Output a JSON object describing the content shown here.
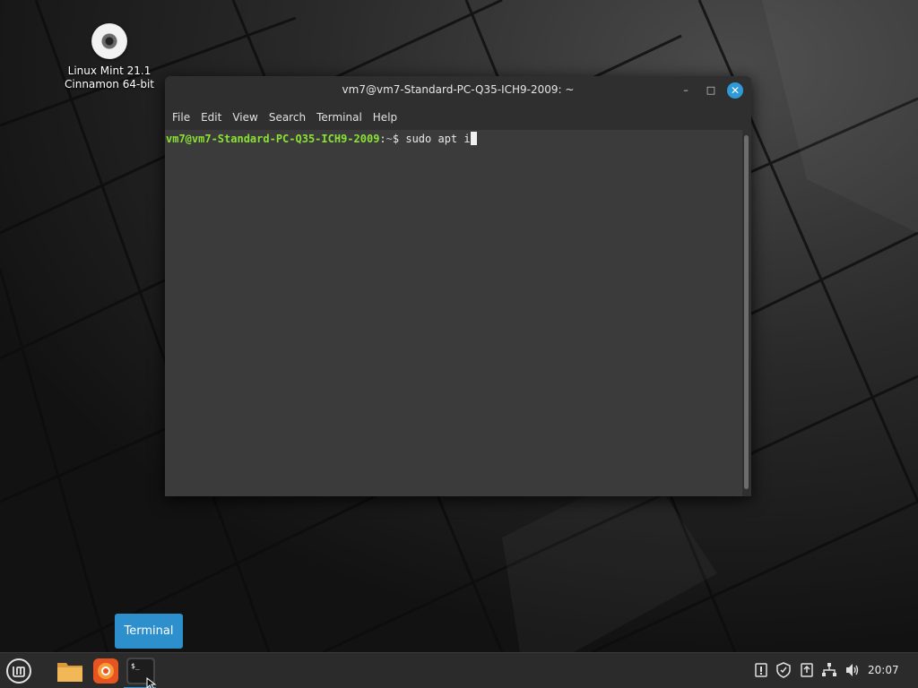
{
  "desktop": {
    "icon": {
      "name": "cdrom-disc-icon",
      "label_line1": "Linux Mint 21.1",
      "label_line2": "Cinnamon 64-bit"
    }
  },
  "terminal_window": {
    "title": "vm7@vm7-Standard-PC-Q35-ICH9-2009: ~",
    "controls": {
      "minimize": "–",
      "maximize": "□",
      "close": "✕"
    },
    "menu": [
      "File",
      "Edit",
      "View",
      "Search",
      "Terminal",
      "Help"
    ],
    "prompt": {
      "user_host": "vm7@vm7-Standard-PC-Q35-ICH9-2009",
      "separator": ":",
      "path": "~",
      "symbol": "$ ",
      "command": "sudo apt i"
    }
  },
  "tooltip": {
    "text": "Terminal"
  },
  "panel": {
    "launchers": [
      {
        "name": "menu-icon"
      },
      {
        "name": "files-folder-icon"
      },
      {
        "name": "firefox-icon"
      },
      {
        "name": "terminal-icon"
      }
    ],
    "tray": [
      {
        "name": "update-manager-icon"
      },
      {
        "name": "shield-icon"
      },
      {
        "name": "clipboard-icon"
      },
      {
        "name": "network-icon"
      },
      {
        "name": "volume-icon"
      }
    ],
    "clock": "20:07"
  },
  "colors": {
    "accent": "#2f9ad8",
    "prompt_user": "#8ae234",
    "terminal_bg": "#3b3b3b",
    "panel_bg": "#2b2b2b"
  }
}
